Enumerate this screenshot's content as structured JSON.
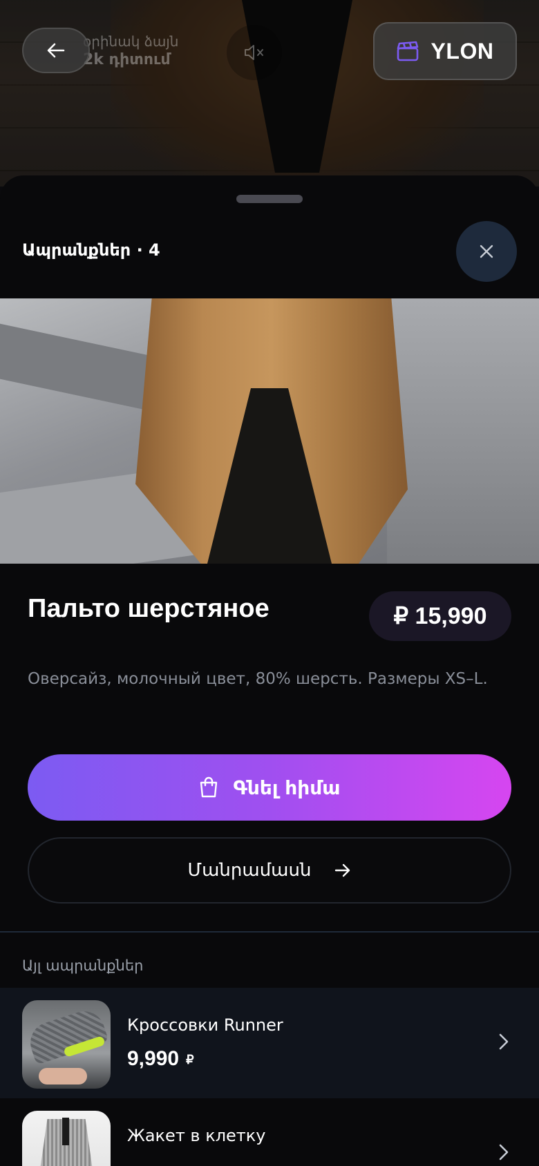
{
  "video": {
    "channel_name": "օրինակ ձայն",
    "views": "2k դիտում",
    "brand_label": "YLON"
  },
  "sheet": {
    "title": "Ապրանքներ · 4"
  },
  "product": {
    "name": "Пальто шерстяное",
    "price": "₽ 15,990",
    "description": "Оверсайз, молочный цвет, 80% шерсть. Размеры XS–L.",
    "buy_label": "Գնել հիմա",
    "details_label": "Մանրամասն"
  },
  "other": {
    "label": "Այլ ապրանքներ",
    "items": [
      {
        "name": "Кроссовки Runner",
        "price": "9,990",
        "currency": "₽"
      },
      {
        "name": "Жакет в клетку",
        "price": "",
        "currency": ""
      }
    ]
  },
  "colors": {
    "accent_start": "#7c5bf2",
    "accent_end": "#d646f0",
    "background": "#09090b"
  },
  "icons": {
    "back": "arrow-left-icon",
    "mute": "volume-mute-icon",
    "brand": "clapperboard-icon",
    "close": "close-icon",
    "buy": "shopping-bag-icon",
    "details": "arrow-right-icon",
    "item": "chevron-right-icon"
  }
}
